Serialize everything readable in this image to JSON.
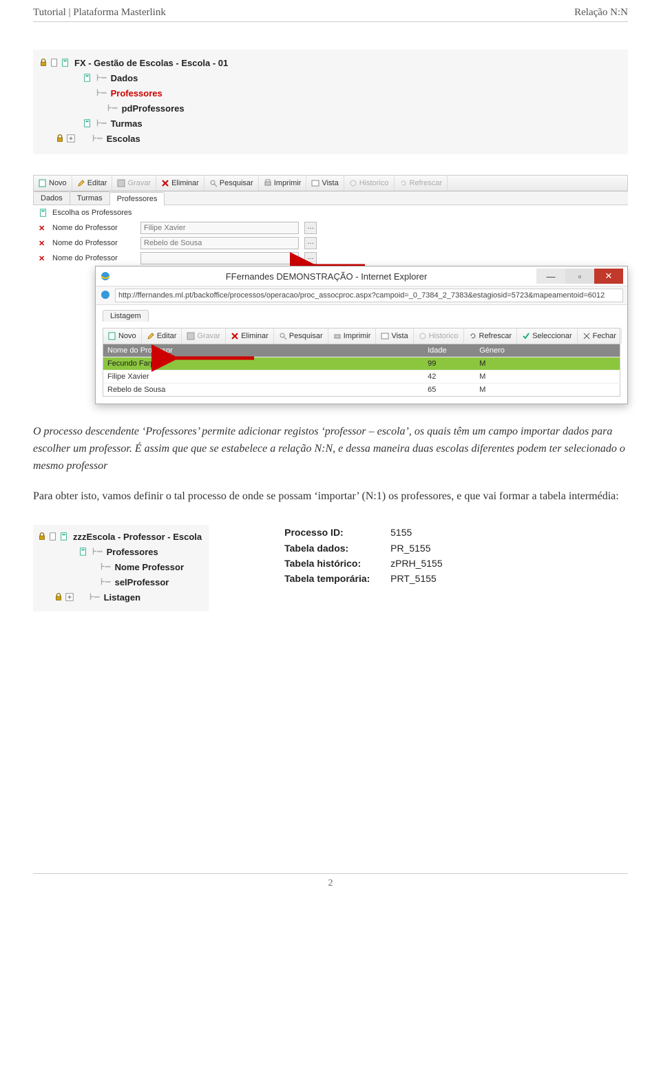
{
  "header": {
    "left": "Tutorial | Plataforma Masterlink",
    "right": "Relação N:N"
  },
  "tree1": {
    "root": "FX - Gestão de Escolas - Escola - 01",
    "items": [
      {
        "label": "Dados",
        "indent": 1
      },
      {
        "label": "Professores",
        "indent": 1,
        "selected": true
      },
      {
        "label": "pdProfessores",
        "indent": 2
      },
      {
        "label": "Turmas",
        "indent": 1
      },
      {
        "label": "Escolas",
        "indent": 1
      }
    ]
  },
  "toolbar_main": [
    "Novo",
    "Editar",
    "Gravar",
    "Eliminar",
    "Pesquisar",
    "Imprimir",
    "Vista",
    "Historico",
    "Refrescar"
  ],
  "tabs_main": [
    "Dados",
    "Turmas",
    "Professores"
  ],
  "tabs_main_active": 2,
  "choose_label": "Escolha os Professores",
  "fields": [
    {
      "label": "Nome do Professor",
      "value": "Filipe Xavier"
    },
    {
      "label": "Nome do Professor",
      "value": "Rebelo de Sousa"
    },
    {
      "label": "Nome do Professor",
      "value": ""
    }
  ],
  "ie": {
    "title": "FFernandes DEMONSTRAÇÃO - Internet Explorer",
    "url": "http://ffernandes.ml.pt/backoffice/processos/operacao/proc_assocproc.aspx?campoid=_0_7384_2_7383&estagiosid=5723&mapeamentoid=6012",
    "list_tab": "Listagem",
    "toolbar": [
      "Novo",
      "Editar",
      "Gravar",
      "Eliminar",
      "Pesquisar",
      "Imprimir",
      "Vista",
      "Historico",
      "Refrescar",
      "Seleccionar",
      "Fechar"
    ],
    "columns": [
      "Nome do Professor",
      "Idade",
      "Género"
    ],
    "rows": [
      {
        "nome": "Fecundo Farpas",
        "idade": "99",
        "genero": "M",
        "hl": true
      },
      {
        "nome": "Filipe Xavier",
        "idade": "42",
        "genero": "M",
        "hl": false
      },
      {
        "nome": "Rebelo de Sousa",
        "idade": "65",
        "genero": "M",
        "hl": false
      }
    ]
  },
  "para1_a": "O processo descendente ‘Professores’ permite adicionar registos ‘professor – escola’, os quais têm um campo importar dados para escolher um professor. ",
  "para1_b": "É assim que que se estabelece a relação N:N, e dessa maneira duas escolas diferentes podem ter selecionado o mesmo professor",
  "para2": "Para obter isto, vamos definir o tal processo de onde se possam ‘importar’ (N:1) os professores, e que vai formar a tabela intermédia:",
  "tree2": {
    "root": "zzzEscola - Professor - Escola",
    "items": [
      {
        "label": "Professores",
        "indent": 1
      },
      {
        "label": "Nome Professor",
        "indent": 2
      },
      {
        "label": "selProfessor",
        "indent": 2,
        "selected": true
      },
      {
        "label": "Listagen",
        "indent": 1
      }
    ]
  },
  "proc": {
    "rows": [
      {
        "label": "Processo ID:",
        "value": "5155"
      },
      {
        "label": "Tabela dados:",
        "value": "PR_5155"
      },
      {
        "label": "Tabela histórico:",
        "value": "zPRH_5155"
      },
      {
        "label": "Tabela temporária:",
        "value": "PRT_5155"
      }
    ]
  },
  "footer": "2"
}
